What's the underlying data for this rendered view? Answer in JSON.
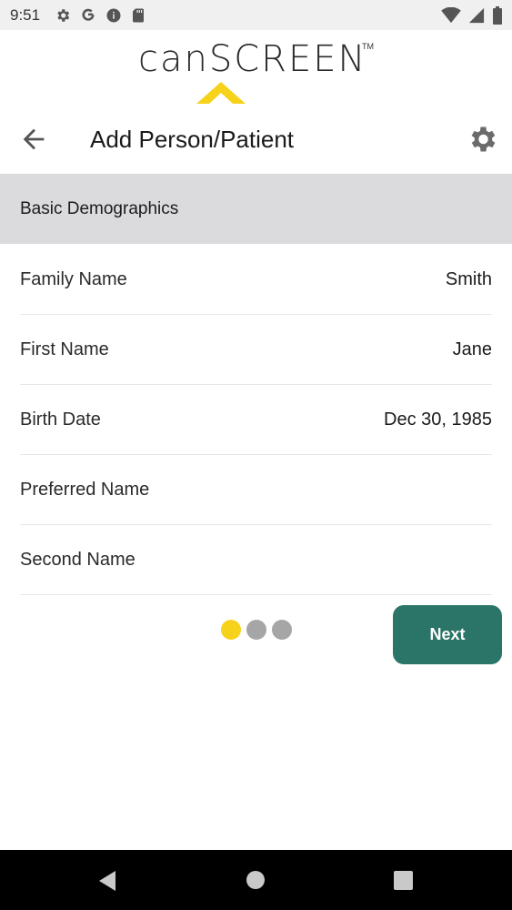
{
  "status_bar": {
    "time": "9:51",
    "left_icons": [
      "settings-icon",
      "google-icon",
      "info-icon",
      "sd-card-icon"
    ],
    "right_icons": [
      "wifi-icon",
      "signal-icon",
      "battery-icon"
    ]
  },
  "logo": {
    "text": "canSCREEN",
    "trademark": "TM",
    "accent_color": "#f7d21a"
  },
  "app_bar": {
    "title": "Add Person/Patient",
    "back_icon": "arrow-back-icon",
    "settings_icon": "gear-icon"
  },
  "section": {
    "title": "Basic Demographics"
  },
  "form": {
    "rows": [
      {
        "label": "Family Name",
        "value": "Smith"
      },
      {
        "label": "First Name",
        "value": "Jane"
      },
      {
        "label": "Birth Date",
        "value": "Dec 30, 1985"
      },
      {
        "label": "Preferred Name",
        "value": ""
      },
      {
        "label": "Second Name",
        "value": ""
      }
    ]
  },
  "pager": {
    "total_steps": 3,
    "current_step": 1,
    "active_color": "#f7d21a",
    "inactive_color": "#a6a6a6"
  },
  "actions": {
    "next_label": "Next",
    "button_color": "#2b7468"
  },
  "nav_bar": {
    "icons": [
      "nav-back-icon",
      "nav-home-icon",
      "nav-recents-icon"
    ]
  }
}
